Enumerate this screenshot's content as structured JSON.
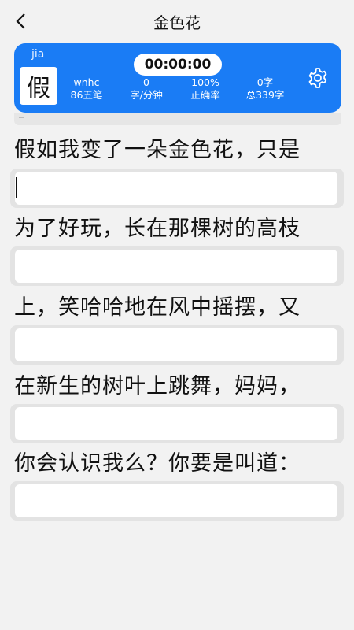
{
  "header": {
    "title": "金色花"
  },
  "panel": {
    "pinyin": "jia",
    "current_char": "假",
    "timer": "00:00:00",
    "stats": [
      {
        "top": "wnhc",
        "bottom": "86五笔"
      },
      {
        "top": "0",
        "bottom": "字/分钟"
      },
      {
        "top": "100%",
        "bottom": "正确率"
      },
      {
        "top": "0字",
        "bottom": "总339字"
      }
    ]
  },
  "lines": [
    {
      "text": "假如我变了一朵金色花，只是",
      "input": ""
    },
    {
      "text": "为了好玩，长在那棵树的高枝",
      "input": ""
    },
    {
      "text": "上，笑哈哈地在风中摇摆，又",
      "input": ""
    },
    {
      "text": "在新生的树叶上跳舞，妈妈，",
      "input": ""
    },
    {
      "text": "你会认识我么？你要是叫道：",
      "input": ""
    }
  ],
  "colors": {
    "accent": "#1a7cf5",
    "background": "#f2f2f2"
  },
  "icons": {
    "back": "chevron-left-icon",
    "settings": "gear-icon"
  }
}
